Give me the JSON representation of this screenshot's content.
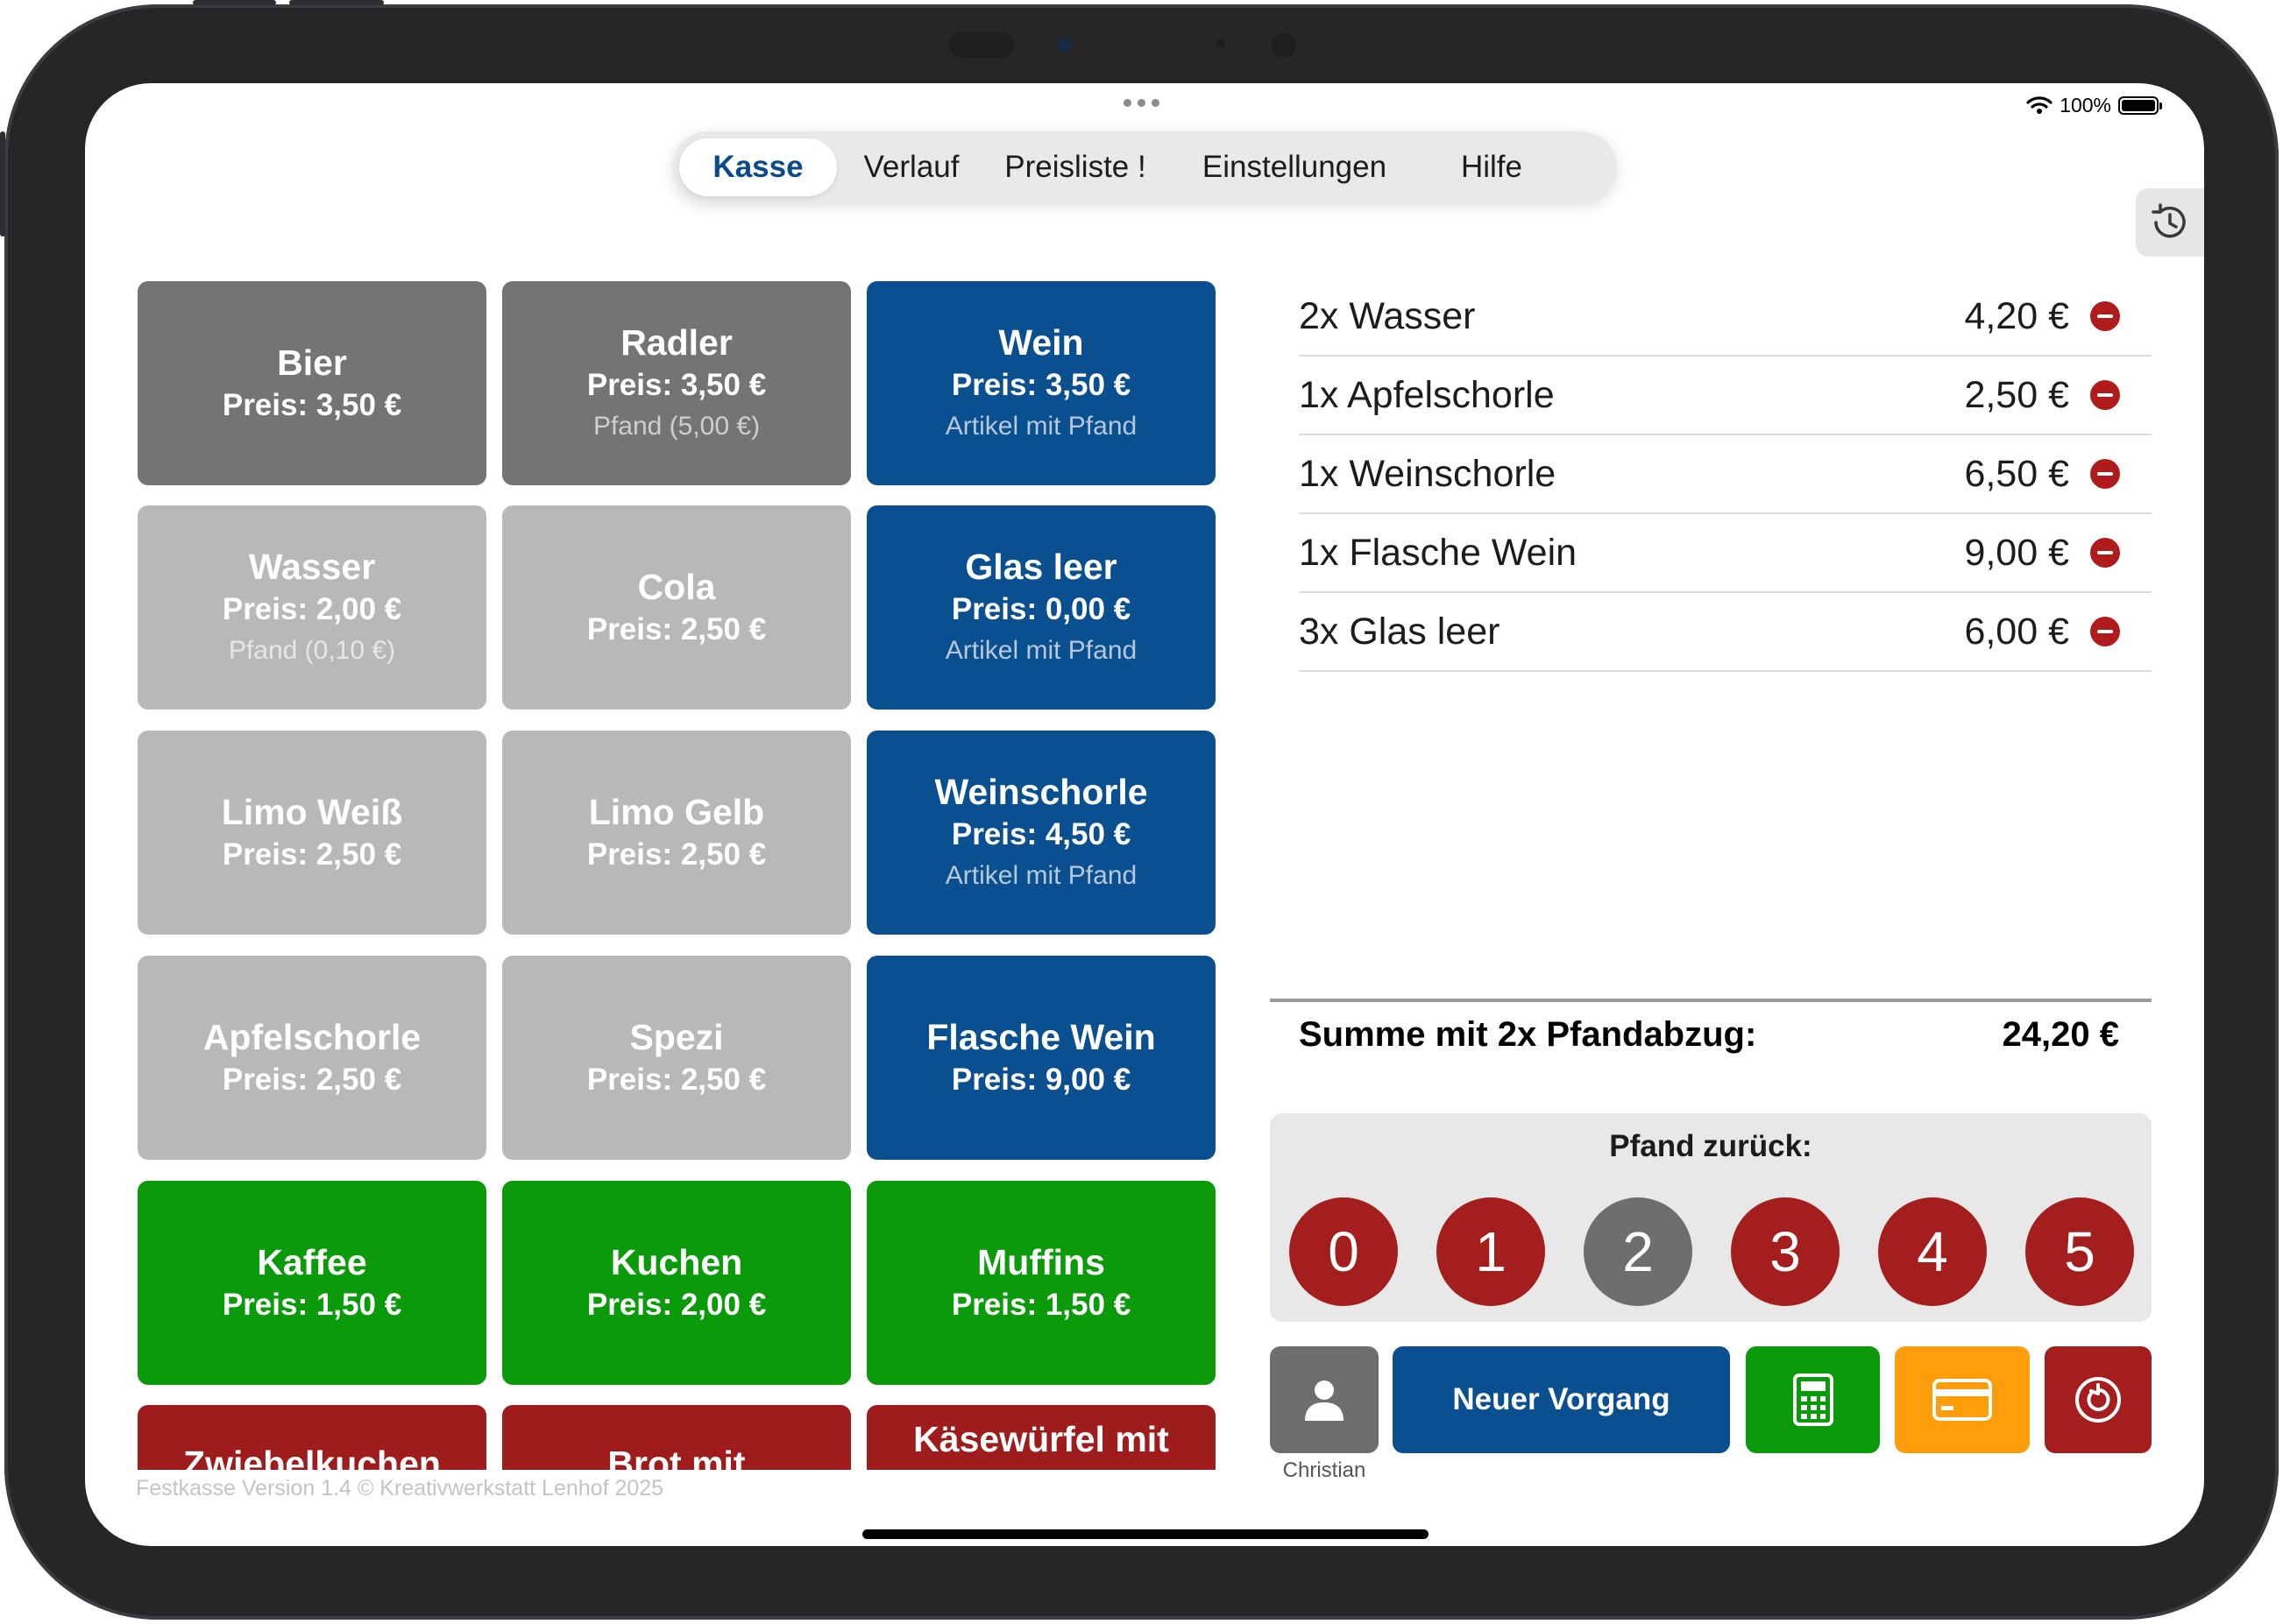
{
  "status_bar": {
    "battery": "100%"
  },
  "tabs": [
    {
      "label": "Kasse",
      "active": true
    },
    {
      "label": "Verlauf",
      "active": false
    },
    {
      "label": "Preisliste !",
      "active": false
    },
    {
      "label": "Einstellungen",
      "active": false
    },
    {
      "label": "Hilfe",
      "active": false
    }
  ],
  "history_button": {
    "icon": "history-clock-icon"
  },
  "products": [
    {
      "name": "Bier",
      "price": "Preis: 3,50 €",
      "sub": "",
      "color": "dark"
    },
    {
      "name": "Radler",
      "price": "Preis: 3,50 €",
      "sub": "Pfand (5,00 €)",
      "color": "dark"
    },
    {
      "name": "Wein",
      "price": "Preis: 3,50 €",
      "sub": "Artikel mit Pfand",
      "color": "blue"
    },
    {
      "name": "Wasser",
      "price": "Preis: 2,00 €",
      "sub": "Pfand (0,10 €)",
      "color": "light"
    },
    {
      "name": "Cola",
      "price": "Preis: 2,50 €",
      "sub": "",
      "color": "light"
    },
    {
      "name": "Glas leer",
      "price": "Preis: 0,00 €",
      "sub": "Artikel mit Pfand",
      "color": "blue"
    },
    {
      "name": "Limo Weiß",
      "price": "Preis: 2,50 €",
      "sub": "",
      "color": "light"
    },
    {
      "name": "Limo Gelb",
      "price": "Preis: 2,50 €",
      "sub": "",
      "color": "light"
    },
    {
      "name": "Weinschorle",
      "price": "Preis: 4,50 €",
      "sub": "Artikel mit Pfand",
      "color": "blue"
    },
    {
      "name": "Apfelschorle",
      "price": "Preis: 2,50 €",
      "sub": "",
      "color": "light"
    },
    {
      "name": "Spezi",
      "price": "Preis: 2,50 €",
      "sub": "",
      "color": "light"
    },
    {
      "name": "Flasche Wein",
      "price": "Preis: 9,00 €",
      "sub": "",
      "color": "blue"
    },
    {
      "name": "Kaffee",
      "price": "Preis: 1,50 €",
      "sub": "",
      "color": "green"
    },
    {
      "name": "Kuchen",
      "price": "Preis: 2,00 €",
      "sub": "",
      "color": "green"
    },
    {
      "name": "Muffins",
      "price": "Preis: 1,50 €",
      "sub": "",
      "color": "green"
    },
    {
      "name": "Zwiebelkuchen",
      "price": "",
      "sub": "",
      "color": "red"
    },
    {
      "name": "Brot mit",
      "price": "",
      "sub": "",
      "color": "red"
    },
    {
      "name": "Käsewürfel mit",
      "price": "",
      "sub": "",
      "color": "red"
    }
  ],
  "order": [
    {
      "label": "2x Wasser",
      "price": "4,20 €"
    },
    {
      "label": "1x Apfelschorle",
      "price": "2,50 €"
    },
    {
      "label": "1x Weinschorle",
      "price": "6,50 €"
    },
    {
      "label": "1x Flasche Wein",
      "price": "9,00 €"
    },
    {
      "label": "3x Glas leer",
      "price": "6,00 €"
    }
  ],
  "summary": {
    "label": "Summe mit 2x Pfandabzug:",
    "value": "24,20 €"
  },
  "pfand": {
    "title": "Pfand zurück:",
    "options": [
      "0",
      "1",
      "2",
      "3",
      "4",
      "5"
    ],
    "selected": "2"
  },
  "actions": {
    "user_name": "Christian",
    "new_transaction": "Neuer Vorgang"
  },
  "footer": "Festkasse Version 1.4 © Kreativwerkstatt Lenhof 2025",
  "colors": {
    "tile_dark": "#747474",
    "tile_light": "#b8b8b8",
    "tile_blue": "#0a4f8f",
    "tile_green": "#0a9a0a",
    "tile_red": "#9e1c1c",
    "accent_orange": "#ff9d0a"
  }
}
